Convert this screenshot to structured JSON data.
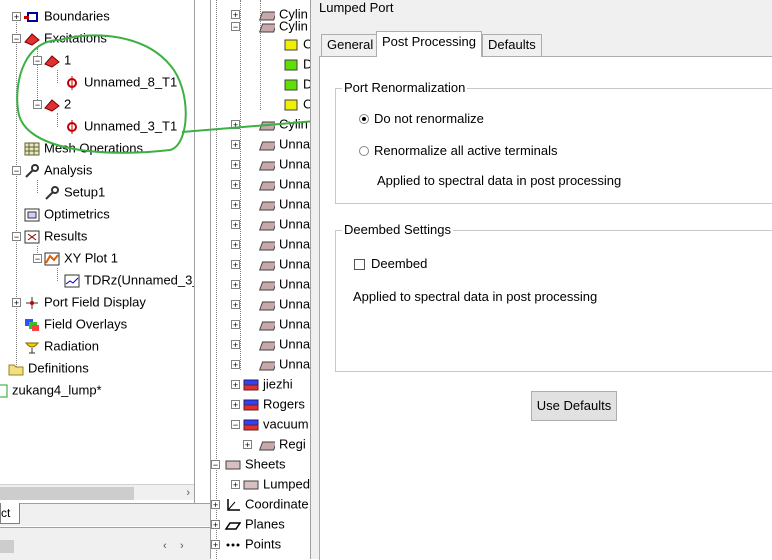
{
  "left_tree": {
    "items": [
      {
        "label": "Boundaries"
      },
      {
        "label": "Excitations"
      },
      {
        "label": "1"
      },
      {
        "label": "Unnamed_8_T1"
      },
      {
        "label": "2"
      },
      {
        "label": "Unnamed_3_T1"
      },
      {
        "label": "Mesh Operations"
      },
      {
        "label": "Analysis"
      },
      {
        "label": "Setup1"
      },
      {
        "label": "Optimetrics"
      },
      {
        "label": "Results"
      },
      {
        "label": "XY Plot 1"
      },
      {
        "label": "TDRz(Unnamed_3_"
      },
      {
        "label": "Port Field Display"
      },
      {
        "label": "Field Overlays"
      },
      {
        "label": "Radiation"
      },
      {
        "label": "Definitions"
      },
      {
        "label": "zukang4_lump*"
      }
    ],
    "tab_label": "ct"
  },
  "mid_tree": {
    "items": [
      {
        "label": "Cylin"
      },
      {
        "label": "Cylin"
      },
      {
        "label": "C"
      },
      {
        "label": "D"
      },
      {
        "label": "D"
      },
      {
        "label": "C"
      },
      {
        "label": "Cylin"
      },
      {
        "label": "Unna"
      },
      {
        "label": "Unna"
      },
      {
        "label": "Unna"
      },
      {
        "label": "Unna"
      },
      {
        "label": "Unna"
      },
      {
        "label": "Unna"
      },
      {
        "label": "Unna"
      },
      {
        "label": "Unna"
      },
      {
        "label": "Unna"
      },
      {
        "label": "Unna"
      },
      {
        "label": "Unna"
      },
      {
        "label": "Unna"
      },
      {
        "label": "jiezhi"
      },
      {
        "label": "Rogers"
      },
      {
        "label": "vacuum"
      },
      {
        "label": "Regi"
      },
      {
        "label": "Sheets"
      },
      {
        "label": "Lumped"
      },
      {
        "label": "Coordinate"
      },
      {
        "label": "Planes"
      },
      {
        "label": "Points"
      }
    ]
  },
  "dialog": {
    "title": "Lumped Port",
    "tabs": [
      {
        "label": "General"
      },
      {
        "label": "Post Processing"
      },
      {
        "label": "Defaults"
      }
    ],
    "port_renorm": {
      "legend": "Port Renormalization",
      "option_do_not": "Do not renormalize",
      "option_renorm_all": "Renormalize all active terminals",
      "note": "Applied to spectral data in post processing",
      "selected": "Do not renormalize"
    },
    "deembed": {
      "legend": "Deembed Settings",
      "checkbox_label": "Deembed",
      "checked": false,
      "note": "Applied to spectral data in post processing"
    },
    "use_defaults_label": "Use Defaults"
  },
  "colors": {
    "annotation_green": "#3cb043",
    "dialog_bg": "#f0f0f0"
  }
}
